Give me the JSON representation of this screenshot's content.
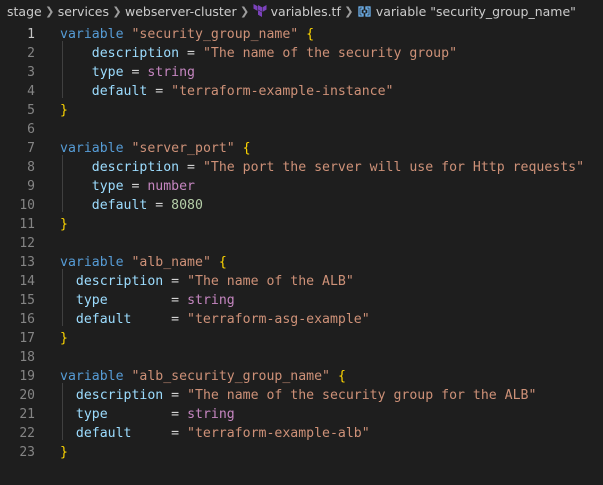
{
  "breadcrumb": {
    "items": [
      "stage",
      "services",
      "webserver-cluster",
      "variables.tf",
      "variable \"security_group_name\""
    ],
    "separator": ">"
  },
  "editor": {
    "active_line": 1,
    "lines": [
      {
        "n": "1",
        "tokens": [
          {
            "t": "variable",
            "c": "kw"
          },
          {
            "t": " ",
            "c": "op"
          },
          {
            "t": "\"security_group_name\"",
            "c": "str"
          },
          {
            "t": " ",
            "c": "op"
          },
          {
            "t": "{",
            "c": "br1"
          }
        ]
      },
      {
        "n": "2",
        "tokens": [
          {
            "t": "    ",
            "c": "op"
          },
          {
            "t": "description",
            "c": "attr"
          },
          {
            "t": " = ",
            "c": "op"
          },
          {
            "t": "\"The name of the security group\"",
            "c": "str"
          }
        ]
      },
      {
        "n": "3",
        "tokens": [
          {
            "t": "    ",
            "c": "op"
          },
          {
            "t": "type",
            "c": "attr"
          },
          {
            "t": " = ",
            "c": "op"
          },
          {
            "t": "string",
            "c": "typ"
          }
        ]
      },
      {
        "n": "4",
        "tokens": [
          {
            "t": "    ",
            "c": "op"
          },
          {
            "t": "default",
            "c": "attr"
          },
          {
            "t": " = ",
            "c": "op"
          },
          {
            "t": "\"terraform-example-instance\"",
            "c": "str"
          }
        ]
      },
      {
        "n": "5",
        "tokens": [
          {
            "t": "}",
            "c": "br1"
          }
        ]
      },
      {
        "n": "6",
        "tokens": []
      },
      {
        "n": "7",
        "tokens": [
          {
            "t": "variable",
            "c": "kw"
          },
          {
            "t": " ",
            "c": "op"
          },
          {
            "t": "\"server_port\"",
            "c": "str"
          },
          {
            "t": " ",
            "c": "op"
          },
          {
            "t": "{",
            "c": "br1"
          }
        ]
      },
      {
        "n": "8",
        "tokens": [
          {
            "t": "    ",
            "c": "op"
          },
          {
            "t": "description",
            "c": "attr"
          },
          {
            "t": " = ",
            "c": "op"
          },
          {
            "t": "\"The port the server will use for Http requests\"",
            "c": "str"
          }
        ]
      },
      {
        "n": "9",
        "tokens": [
          {
            "t": "    ",
            "c": "op"
          },
          {
            "t": "type",
            "c": "attr"
          },
          {
            "t": " = ",
            "c": "op"
          },
          {
            "t": "number",
            "c": "typ"
          }
        ]
      },
      {
        "n": "10",
        "tokens": [
          {
            "t": "    ",
            "c": "op"
          },
          {
            "t": "default",
            "c": "attr"
          },
          {
            "t": " = ",
            "c": "op"
          },
          {
            "t": "8080",
            "c": "num"
          }
        ]
      },
      {
        "n": "11",
        "tokens": [
          {
            "t": "}",
            "c": "br1"
          }
        ]
      },
      {
        "n": "12",
        "tokens": []
      },
      {
        "n": "13",
        "tokens": [
          {
            "t": "variable",
            "c": "kw"
          },
          {
            "t": " ",
            "c": "op"
          },
          {
            "t": "\"alb_name\"",
            "c": "str"
          },
          {
            "t": " ",
            "c": "op"
          },
          {
            "t": "{",
            "c": "br1"
          }
        ]
      },
      {
        "n": "14",
        "tokens": [
          {
            "t": "  ",
            "c": "op"
          },
          {
            "t": "description",
            "c": "attr"
          },
          {
            "t": " = ",
            "c": "op"
          },
          {
            "t": "\"The name of the ALB\"",
            "c": "str"
          }
        ]
      },
      {
        "n": "15",
        "tokens": [
          {
            "t": "  ",
            "c": "op"
          },
          {
            "t": "type",
            "c": "attr"
          },
          {
            "t": "        = ",
            "c": "op"
          },
          {
            "t": "string",
            "c": "typ"
          }
        ]
      },
      {
        "n": "16",
        "tokens": [
          {
            "t": "  ",
            "c": "op"
          },
          {
            "t": "default",
            "c": "attr"
          },
          {
            "t": "     = ",
            "c": "op"
          },
          {
            "t": "\"terraform-asg-example\"",
            "c": "str"
          }
        ]
      },
      {
        "n": "17",
        "tokens": [
          {
            "t": "}",
            "c": "br1"
          }
        ]
      },
      {
        "n": "18",
        "tokens": []
      },
      {
        "n": "19",
        "tokens": [
          {
            "t": "variable",
            "c": "kw"
          },
          {
            "t": " ",
            "c": "op"
          },
          {
            "t": "\"alb_security_group_name\"",
            "c": "str"
          },
          {
            "t": " ",
            "c": "op"
          },
          {
            "t": "{",
            "c": "br1"
          }
        ]
      },
      {
        "n": "20",
        "tokens": [
          {
            "t": "  ",
            "c": "op"
          },
          {
            "t": "description",
            "c": "attr"
          },
          {
            "t": " = ",
            "c": "op"
          },
          {
            "t": "\"The name of the security group for the ALB\"",
            "c": "str"
          }
        ]
      },
      {
        "n": "21",
        "tokens": [
          {
            "t": "  ",
            "c": "op"
          },
          {
            "t": "type",
            "c": "attr"
          },
          {
            "t": "        = ",
            "c": "op"
          },
          {
            "t": "string",
            "c": "typ"
          }
        ]
      },
      {
        "n": "22",
        "tokens": [
          {
            "t": "  ",
            "c": "op"
          },
          {
            "t": "default",
            "c": "attr"
          },
          {
            "t": "     = ",
            "c": "op"
          },
          {
            "t": "\"terraform-example-alb\"",
            "c": "str"
          }
        ]
      },
      {
        "n": "23",
        "tokens": [
          {
            "t": "}",
            "c": "br1"
          }
        ]
      }
    ]
  },
  "colors": {
    "background": "#1e1e1e",
    "keyword": "#569cd6",
    "string": "#ce9178",
    "attribute": "#9cdcfe",
    "type": "#c586c0",
    "number": "#b5cea8",
    "bracket": "#ffd700",
    "line_number": "#858585"
  },
  "icons": {
    "file_icon": "terraform-icon",
    "symbol_icon": "variable-symbol-icon"
  }
}
